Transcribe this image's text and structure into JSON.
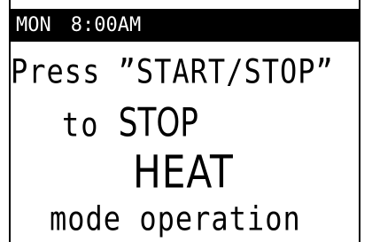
{
  "status": {
    "day": "MON",
    "time": "8:00AM"
  },
  "message": {
    "line1": "Press ”START/STOP”",
    "line2_prefix": "to",
    "line2_action": "STOP",
    "line3": "HEAT",
    "line4": "mode operation"
  },
  "colors": {
    "background": "#ffffff",
    "text": "#000000",
    "status_bar_bg": "#000000",
    "status_bar_text": "#ffffff"
  }
}
